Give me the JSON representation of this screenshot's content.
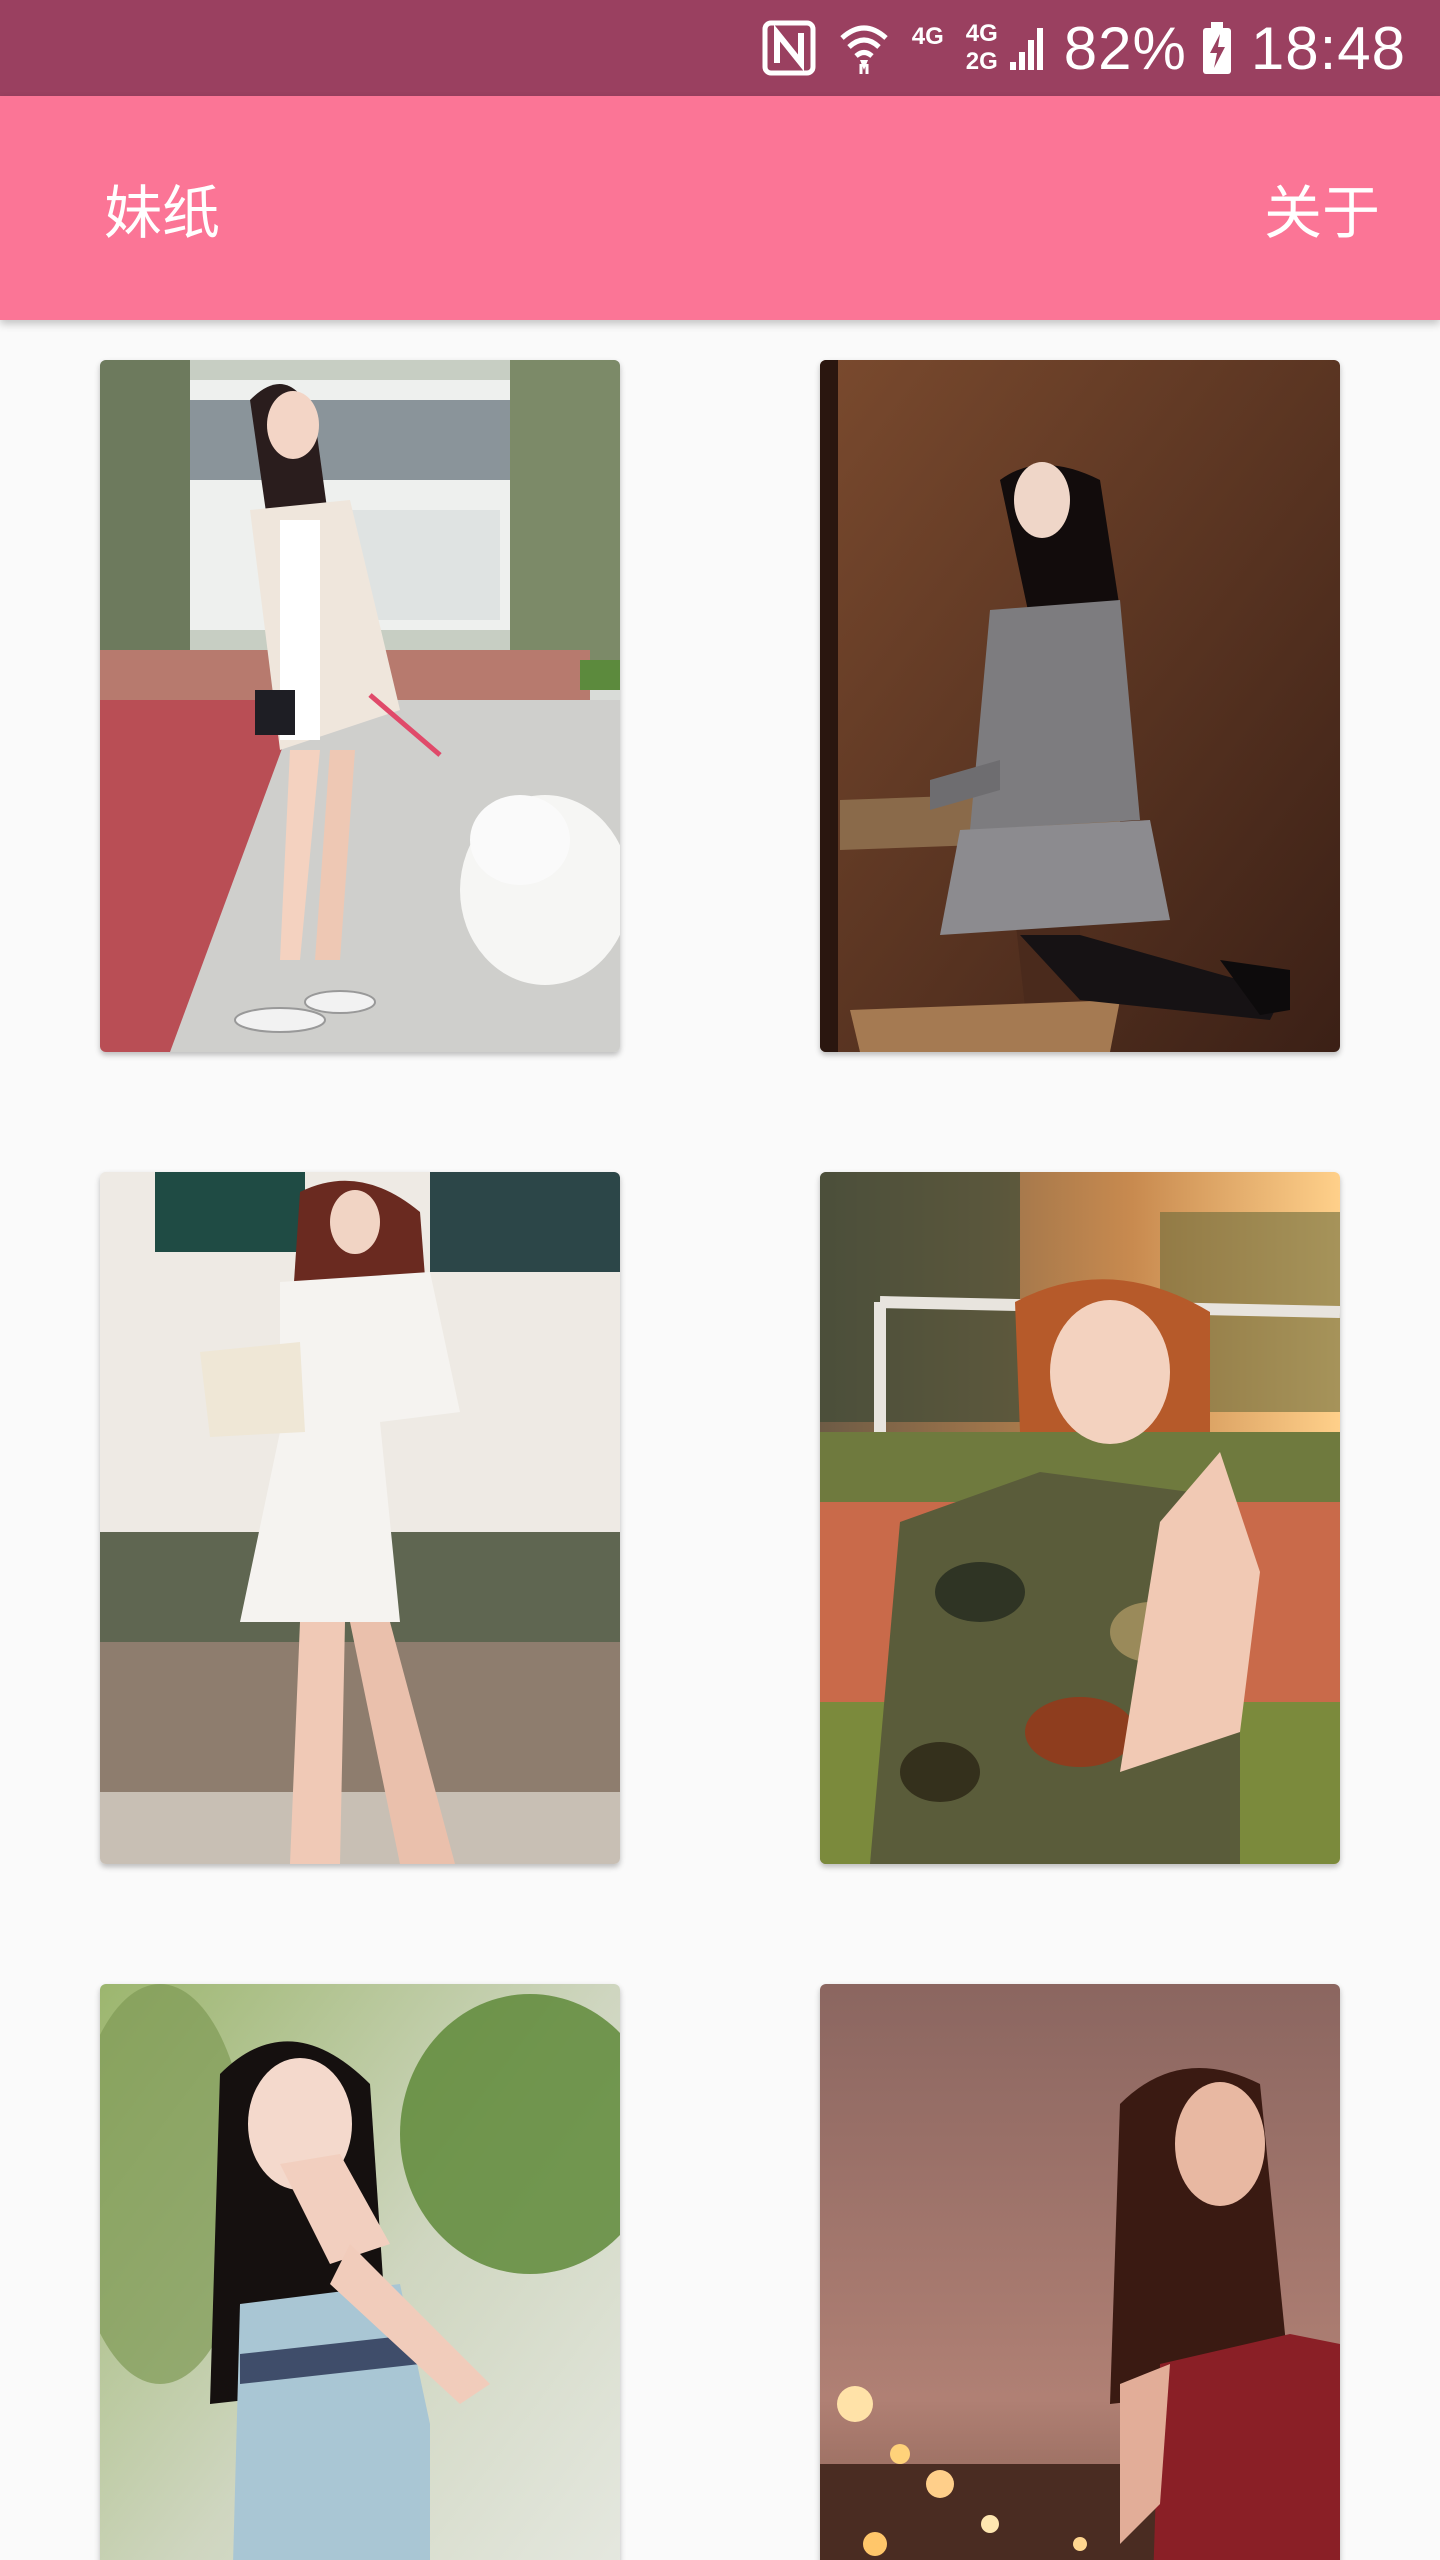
{
  "status_bar": {
    "icons": [
      "nfc-icon",
      "wifi-icon",
      "signal-4g-icon",
      "signal-4g-2g-icon",
      "battery-charging-icon"
    ],
    "network_4g": "4G",
    "network_4g2": "4G",
    "network_2g": "2G",
    "battery": "82%",
    "time": "18:48"
  },
  "app_bar": {
    "title": "妹纸",
    "about_label": "关于",
    "color": "#fb7596"
  },
  "gallery": {
    "items": [
      {
        "scene": "photo-girl-white-cardigan-with-dog"
      },
      {
        "scene": "photo-girl-grey-dress-wooden-wall"
      },
      {
        "scene": "photo-girl-white-dress-street"
      },
      {
        "scene": "photo-girl-camo-jacket-sunset-field"
      },
      {
        "scene": "photo-girl-blue-top-greenery"
      },
      {
        "scene": "photo-girl-red-dress-city-lights"
      }
    ]
  }
}
